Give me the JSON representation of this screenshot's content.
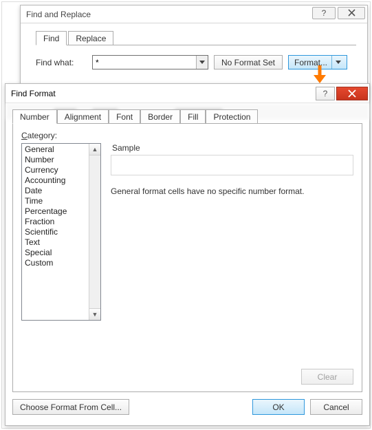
{
  "findReplace": {
    "title": "Find and Replace",
    "tabs": {
      "find": "Find",
      "replace": "Replace"
    },
    "findWhatLabel": "Find what:",
    "findWhatValue": "*",
    "noFormatLabel": "No Format Set",
    "formatLabel": "Format..."
  },
  "findFormat": {
    "title": "Find Format",
    "tabs": {
      "number": "Number",
      "alignment": "Alignment",
      "font": "Font",
      "border": "Border",
      "fill": "Fill",
      "protection": "Protection"
    },
    "categoryLabelPrefix": "C",
    "categoryLabelRest": "ategory:",
    "categories": [
      "General",
      "Number",
      "Currency",
      "Accounting",
      "Date",
      "Time",
      "Percentage",
      "Fraction",
      "Scientific",
      "Text",
      "Special",
      "Custom"
    ],
    "sampleLabel": "Sample",
    "description": "General format cells have no specific number format.",
    "clearLabel": "Clear",
    "chooseFromCellLabel": "Choose Format From Cell...",
    "okLabel": "OK",
    "cancelLabel": "Cancel"
  }
}
